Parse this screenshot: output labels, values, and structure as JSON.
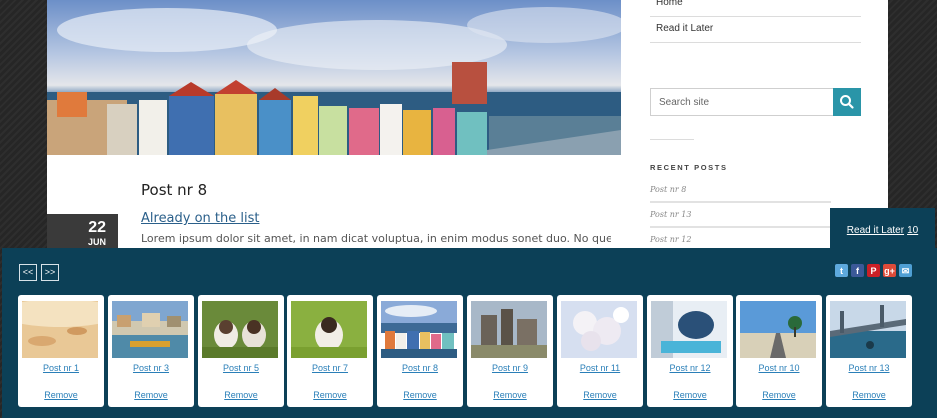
{
  "post": {
    "title": "Post nr 8",
    "already_label": "Already on the list",
    "excerpt": "Lorem ipsum dolor sit amet, in nam dicat voluptua, in enim modus sonet duo. No quem",
    "date_day": "22",
    "date_month": "JUN"
  },
  "sidebar": {
    "nav": [
      "Home",
      "Read it Later"
    ],
    "search_placeholder": "Search site",
    "recent_title": "RECENT POSTS",
    "recent": [
      "Post nr 8",
      "Post nr 13",
      "Post nr 12"
    ]
  },
  "ril_tab": {
    "label": "Read it Later",
    "count": "10"
  },
  "bar": {
    "prev_label": "<<",
    "next_label": ">>",
    "social": [
      {
        "icon": "twitter-icon",
        "color": "#5ea9dd"
      },
      {
        "icon": "facebook-icon",
        "color": "#3b5998"
      },
      {
        "icon": "pinterest-icon",
        "color": "#cb2027"
      },
      {
        "icon": "google-plus-icon",
        "color": "#dd4b39"
      },
      {
        "icon": "email-icon",
        "color": "#4f9fd4"
      }
    ],
    "items": [
      {
        "title": "Post nr 1",
        "remove": "Remove",
        "thumb": "sand"
      },
      {
        "title": "Post nr 3",
        "remove": "Remove",
        "thumb": "harbor"
      },
      {
        "title": "Post nr 5",
        "remove": "Remove",
        "thumb": "cats"
      },
      {
        "title": "Post nr 7",
        "remove": "Remove",
        "thumb": "cat-grass"
      },
      {
        "title": "Post nr 8",
        "remove": "Remove",
        "thumb": "town"
      },
      {
        "title": "Post nr 9",
        "remove": "Remove",
        "thumb": "ruins"
      },
      {
        "title": "Post nr 11",
        "remove": "Remove",
        "thumb": "flowers"
      },
      {
        "title": "Post nr 12",
        "remove": "Remove",
        "thumb": "pool"
      },
      {
        "title": "Post nr 10",
        "remove": "Remove",
        "thumb": "road"
      },
      {
        "title": "Post nr 13",
        "remove": "Remove",
        "thumb": "bridge"
      }
    ]
  },
  "colors": {
    "bar_bg": "#0c4057",
    "accent": "#2a95a8",
    "link": "#2a7fb8"
  }
}
